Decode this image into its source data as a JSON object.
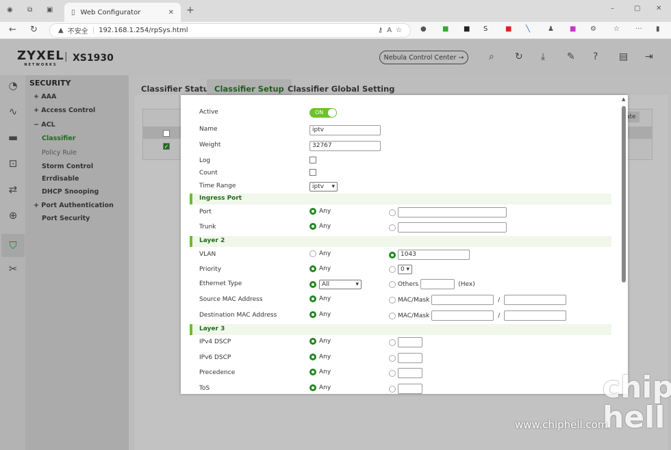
{
  "browser": {
    "tab_title": "Web Configurator",
    "not_secure": "不安全",
    "url": "192.168.1.254/rpSys.html"
  },
  "header": {
    "brand": "ZYXEL",
    "brand_sub": "NETWORKS",
    "model": "XS1930",
    "nebula_button": "Nebula Control Center →"
  },
  "sidebar": {
    "section": "SECURITY",
    "items": [
      {
        "prefix": "+",
        "label": "AAA"
      },
      {
        "prefix": "+",
        "label": "Access Control"
      },
      {
        "prefix": "−",
        "label": "ACL"
      },
      {
        "prefix": "",
        "label": "Classifier"
      },
      {
        "prefix": "",
        "label": "Policy Rule"
      },
      {
        "prefix": "",
        "label": "Storm Control"
      },
      {
        "prefix": "",
        "label": "Errdisable"
      },
      {
        "prefix": "",
        "label": "DHCP Snooping"
      },
      {
        "prefix": "+",
        "label": "Port Authentication"
      },
      {
        "prefix": "",
        "label": "Port Security"
      }
    ]
  },
  "tabs": [
    "Classifier Status",
    "Classifier Setup",
    "Classifier Global Setting"
  ],
  "background_button": "ate",
  "form": {
    "active_label": "Active",
    "active_value": "ON",
    "name_label": "Name",
    "name_value": "iptv",
    "weight_label": "Weight",
    "weight_value": "32767",
    "log_label": "Log",
    "count_label": "Count",
    "time_range_label": "Time Range",
    "time_range_value": "iptv",
    "ingress_header": "Ingress Port",
    "port_label": "Port",
    "trunk_label": "Trunk",
    "layer2_header": "Layer 2",
    "vlan_label": "VLAN",
    "vlan_value": "1043",
    "priority_label": "Priority",
    "priority_value": "0",
    "ethertype_label": "Ethernet Type",
    "ethertype_value": "All",
    "others_label": "Others",
    "hex_label": "(Hex)",
    "src_mac_label": "Source MAC Address",
    "dst_mac_label": "Destination MAC Address",
    "mac_mask_label": "MAC/Mask",
    "slash": "/",
    "layer3_header": "Layer 3",
    "ipv4_dscp_label": "IPv4 DSCP",
    "ipv6_dscp_label": "IPv6 DSCP",
    "precedence_label": "Precedence",
    "tos_label": "ToS",
    "any": "Any"
  },
  "watermark": {
    "url": "www.chiphell.com",
    "logo": "chip hell"
  },
  "colors": {
    "accent": "#1f8a1f",
    "toggle": "#6cc22a",
    "section_bar": "#6cbd2d"
  }
}
